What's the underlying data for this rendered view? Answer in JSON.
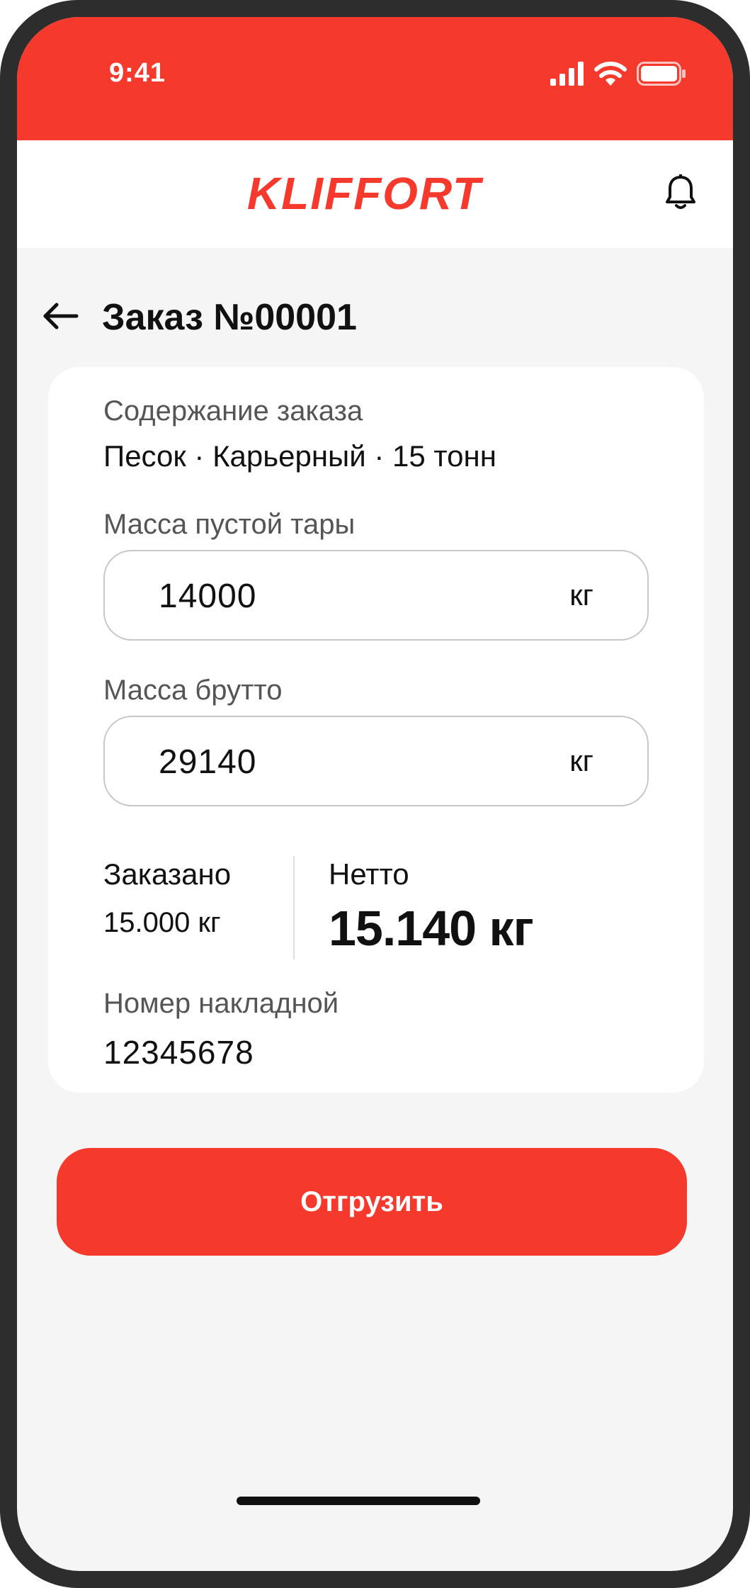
{
  "status_bar": {
    "time": "9:41",
    "icons": [
      "cellular-signal-icon",
      "wifi-icon",
      "battery-icon"
    ],
    "color": "#f5392d"
  },
  "header": {
    "logo": "KLIFFORT",
    "notification_icon": "bell-icon"
  },
  "page": {
    "back_icon": "arrow-left-icon",
    "title": "Заказ №00001"
  },
  "order": {
    "contents_label": "Содержание заказа",
    "contents_value": "Песок · Карьерный · 15 тонн",
    "tare_label": "Масса пустой тары",
    "tare_value": "14000",
    "tare_unit": "кг",
    "gross_label": "Масса брутто",
    "gross_value": "29140",
    "gross_unit": "кг",
    "ordered_label": "Заказано",
    "ordered_value": "15.000 кг",
    "net_label": "Нетто",
    "net_value": "15.140 кг",
    "waybill_label": "Номер накладной",
    "waybill_value": "12345678"
  },
  "actions": {
    "ship_label": "Отгрузить"
  },
  "colors": {
    "accent": "#f5392d",
    "background": "#f5f5f5",
    "card": "#ffffff"
  }
}
